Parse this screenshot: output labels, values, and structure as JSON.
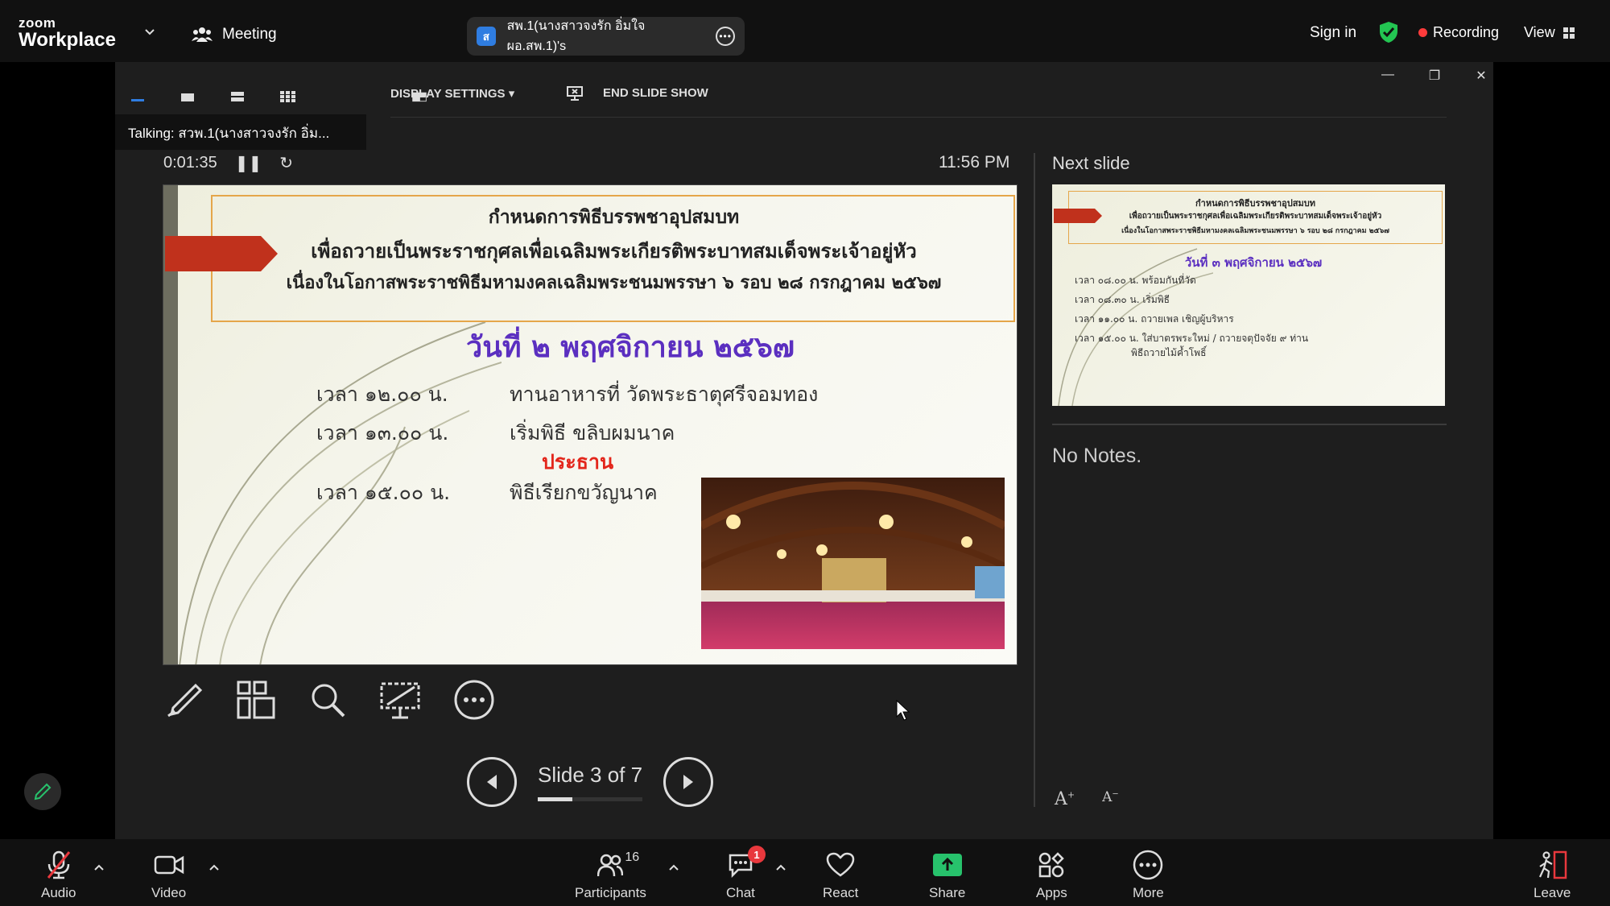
{
  "app": {
    "logo_top": "zoom",
    "logo_bottom": "Workplace",
    "meeting_label": "Meeting"
  },
  "tab": {
    "initial": "ส",
    "title": "สพ.1(นางสาวจงรัก อิ่มใจ ผอ.สพ.1)'s"
  },
  "header": {
    "sign_in": "Sign in",
    "recording": "Recording",
    "view": "View"
  },
  "presenter": {
    "display_settings": "DISPLAY SETTINGS ▾",
    "end_slide_show": "END SLIDE SHOW",
    "talking": "Talking: สวพ.1(นางสาวจงรัก อิ่ม...",
    "elapsed": "0:01:35",
    "clock": "11:56 PM",
    "next_slide_label": "Next slide",
    "notes": "No Notes.",
    "slide_counter": "Slide 3 of 7",
    "slide_progress": 0.33
  },
  "slide": {
    "line1": "กำหนดการพิธีบรรพชาอุปสมบท",
    "line2": "เพื่อถวายเป็นพระราชกุศลเพื่อเฉลิมพระเกียรติพระบาทสมเด็จพระเจ้าอยู่หัว",
    "line3": "เนื่องในโอกาสพระราชพิธีมหามงคลเฉลิมพระชนมพรรษา ๖ รอบ ๒๘ กรกฎาคม ๒๕๖๗",
    "date": "วันที่ ๒ พฤศจิกายน ๒๕๖๗",
    "rows": [
      {
        "time": "เวลา ๑๒.๐๐ น.",
        "text": "ทานอาหารที่ วัดพระธาตุศรีจอมทอง"
      },
      {
        "time": "เวลา ๑๓.๐๐ น.",
        "text": "เริ่มพิธี ขลิบผมนาค"
      },
      {
        "time": "",
        "text": "ประธาน"
      },
      {
        "time": "เวลา ๑๕.๐๐ น.",
        "text": "พิธีเรียกขวัญนาค"
      }
    ]
  },
  "next_slide": {
    "line1": "กำหนดการพิธีบรรพชาอุปสมบท",
    "line2": "เพื่อถวายเป็นพระราชกุศลเพื่อเฉลิมพระเกียรติพระบาทสมเด็จพระเจ้าอยู่หัว",
    "line3": "เนื่องในโอกาสพระราชพิธีมหามงคลเฉลิมพระชนมพรรษา ๖ รอบ ๒๘ กรกฎาคม ๒๕๖๗",
    "date": "วันที่ ๓ พฤศจิกายน ๒๕๖๗",
    "rows": [
      "เวลา ๐๘.๐๐ น. พร้อมกันที่วัด",
      "เวลา ๐๘.๓๐ น. เริ่มพิธี",
      "เวลา ๑๑.๐๐ น. ถวายเพล เชิญผู้บริหาร",
      "เวลา ๑๕.๐๐ น. ใส่บาตรพระใหม่ / ถวายจตุปัจจัย ๙ ท่าน",
      "พิธีถวายไม้ค้ำโพธิ์"
    ]
  },
  "toolbar": {
    "audio": "Audio",
    "video": "Video",
    "participants": "Participants",
    "participants_count": "16",
    "chat": "Chat",
    "chat_badge": "1",
    "react": "React",
    "share": "Share",
    "apps": "Apps",
    "more": "More",
    "leave": "Leave"
  },
  "colors": {
    "share_green": "#27c26c",
    "recording_red": "#ff3b3b",
    "shield_green": "#23c552",
    "slide_purple": "#5b2fc0",
    "slide_red": "#e3261b"
  }
}
